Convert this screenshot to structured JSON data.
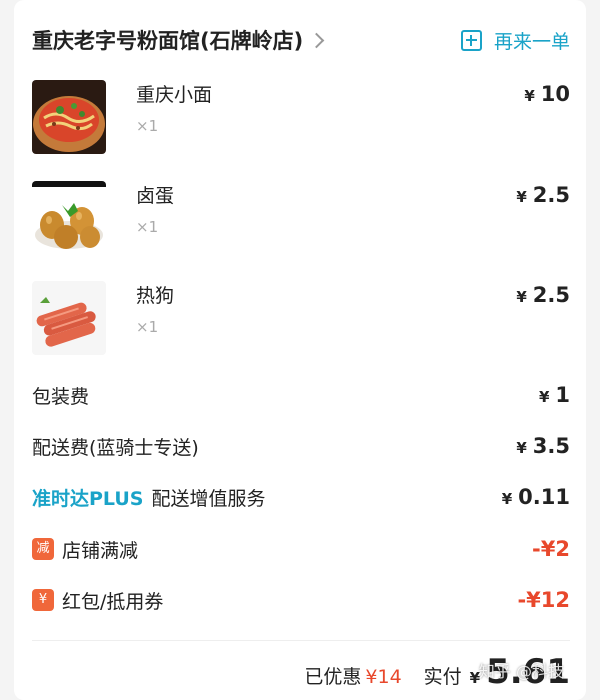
{
  "store": {
    "name": "重庆老字号粉面馆(石牌岭店)",
    "reorder_label": "再来一单"
  },
  "currency": "¥",
  "items": [
    {
      "name": "重庆小面",
      "qty": "×1",
      "price": "10",
      "image": "noodle-bowl-image"
    },
    {
      "name": "卤蛋",
      "qty": "×1",
      "price": "2.5",
      "image": "braised-egg-image"
    },
    {
      "name": "热狗",
      "qty": "×1",
      "price": "2.5",
      "image": "hot-dog-image"
    }
  ],
  "fees": {
    "packaging": {
      "label": "包装费",
      "price": "1"
    },
    "delivery": {
      "label": "配送费(蓝骑士专送)",
      "price": "3.5"
    },
    "ontime": {
      "tag": "准时达PLUS",
      "label": "配送增值服务",
      "price": "0.11"
    },
    "store_discount": {
      "badge": "减",
      "label": "店铺满减",
      "price": "-¥2"
    },
    "coupon": {
      "badge": "¥",
      "label": "红包/抵用券",
      "price": "-¥12"
    }
  },
  "summary": {
    "discount_label": "已优惠",
    "discount_value": "¥14",
    "paid_label": "实付",
    "paid_currency": "¥",
    "paid_value": "5.61"
  },
  "watermark": "知乎 @科技",
  "colors": {
    "accent": "#1aa3c8",
    "discount_red": "#e8482c",
    "badge_orange": "#f0673a"
  }
}
